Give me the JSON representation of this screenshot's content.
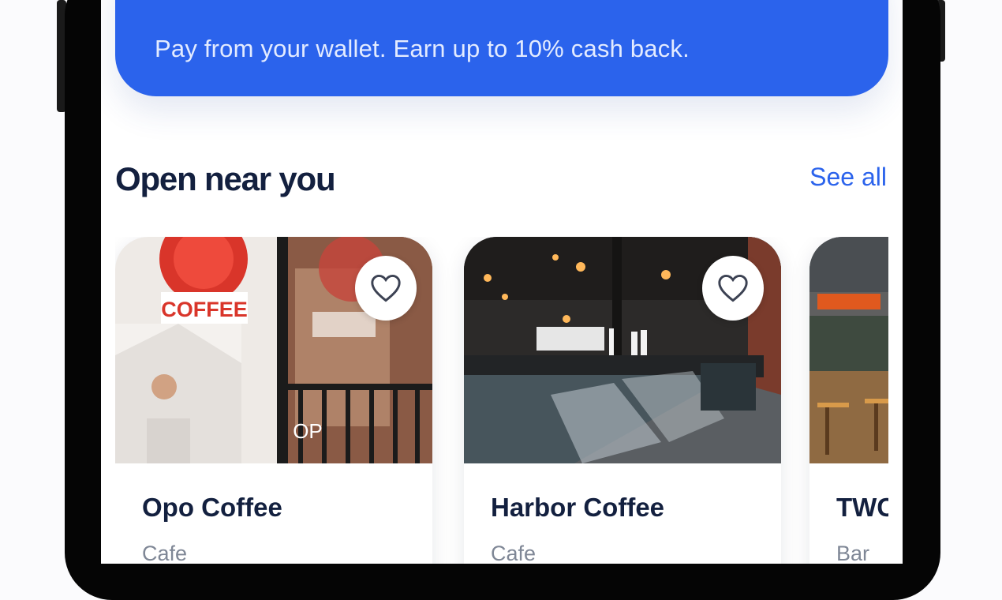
{
  "wallet_banner": {
    "text": "Pay from your wallet. Earn up to 10% cash back."
  },
  "section": {
    "title": "Open near you",
    "see_all": "See all"
  },
  "places": [
    {
      "name": "Opo Coffee",
      "category": "Cafe",
      "sign_text": "COFFEE",
      "door_text": "OP"
    },
    {
      "name": "Harbor Coffee",
      "category": "Cafe"
    },
    {
      "name": "TWC",
      "category": "Bar"
    }
  ],
  "colors": {
    "accent": "#2b63ec",
    "title": "#13203f",
    "subtle": "#7f8796"
  }
}
